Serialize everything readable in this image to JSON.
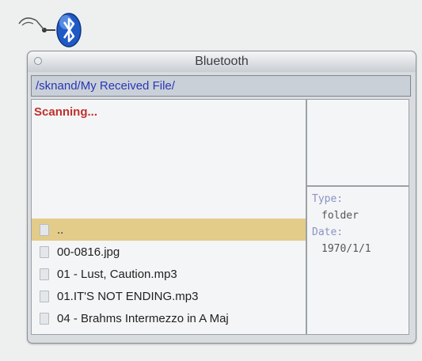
{
  "window": {
    "title": "Bluetooth",
    "path": "/sknand/My Received File/"
  },
  "status": "Scanning...",
  "files": [
    {
      "name": "..",
      "selected": true
    },
    {
      "name": "00-0816.jpg",
      "selected": false
    },
    {
      "name": "01 - Lust, Caution.mp3",
      "selected": false
    },
    {
      "name": "01.IT'S NOT ENDING.mp3",
      "selected": false
    },
    {
      "name": "04 - Brahms Intermezzo in A Maj",
      "selected": false
    }
  ],
  "info": {
    "type_label": "Type:",
    "type_value": "folder",
    "date_label": "Date:",
    "date_value": "1970/1/1"
  },
  "colors": {
    "status": "#c0302c",
    "path": "#2a36b5",
    "selection": "#e3cc8a",
    "info_label": "#8a93c6"
  },
  "icons": {
    "desktop": "bluetooth-icon",
    "file": "file-icon"
  }
}
